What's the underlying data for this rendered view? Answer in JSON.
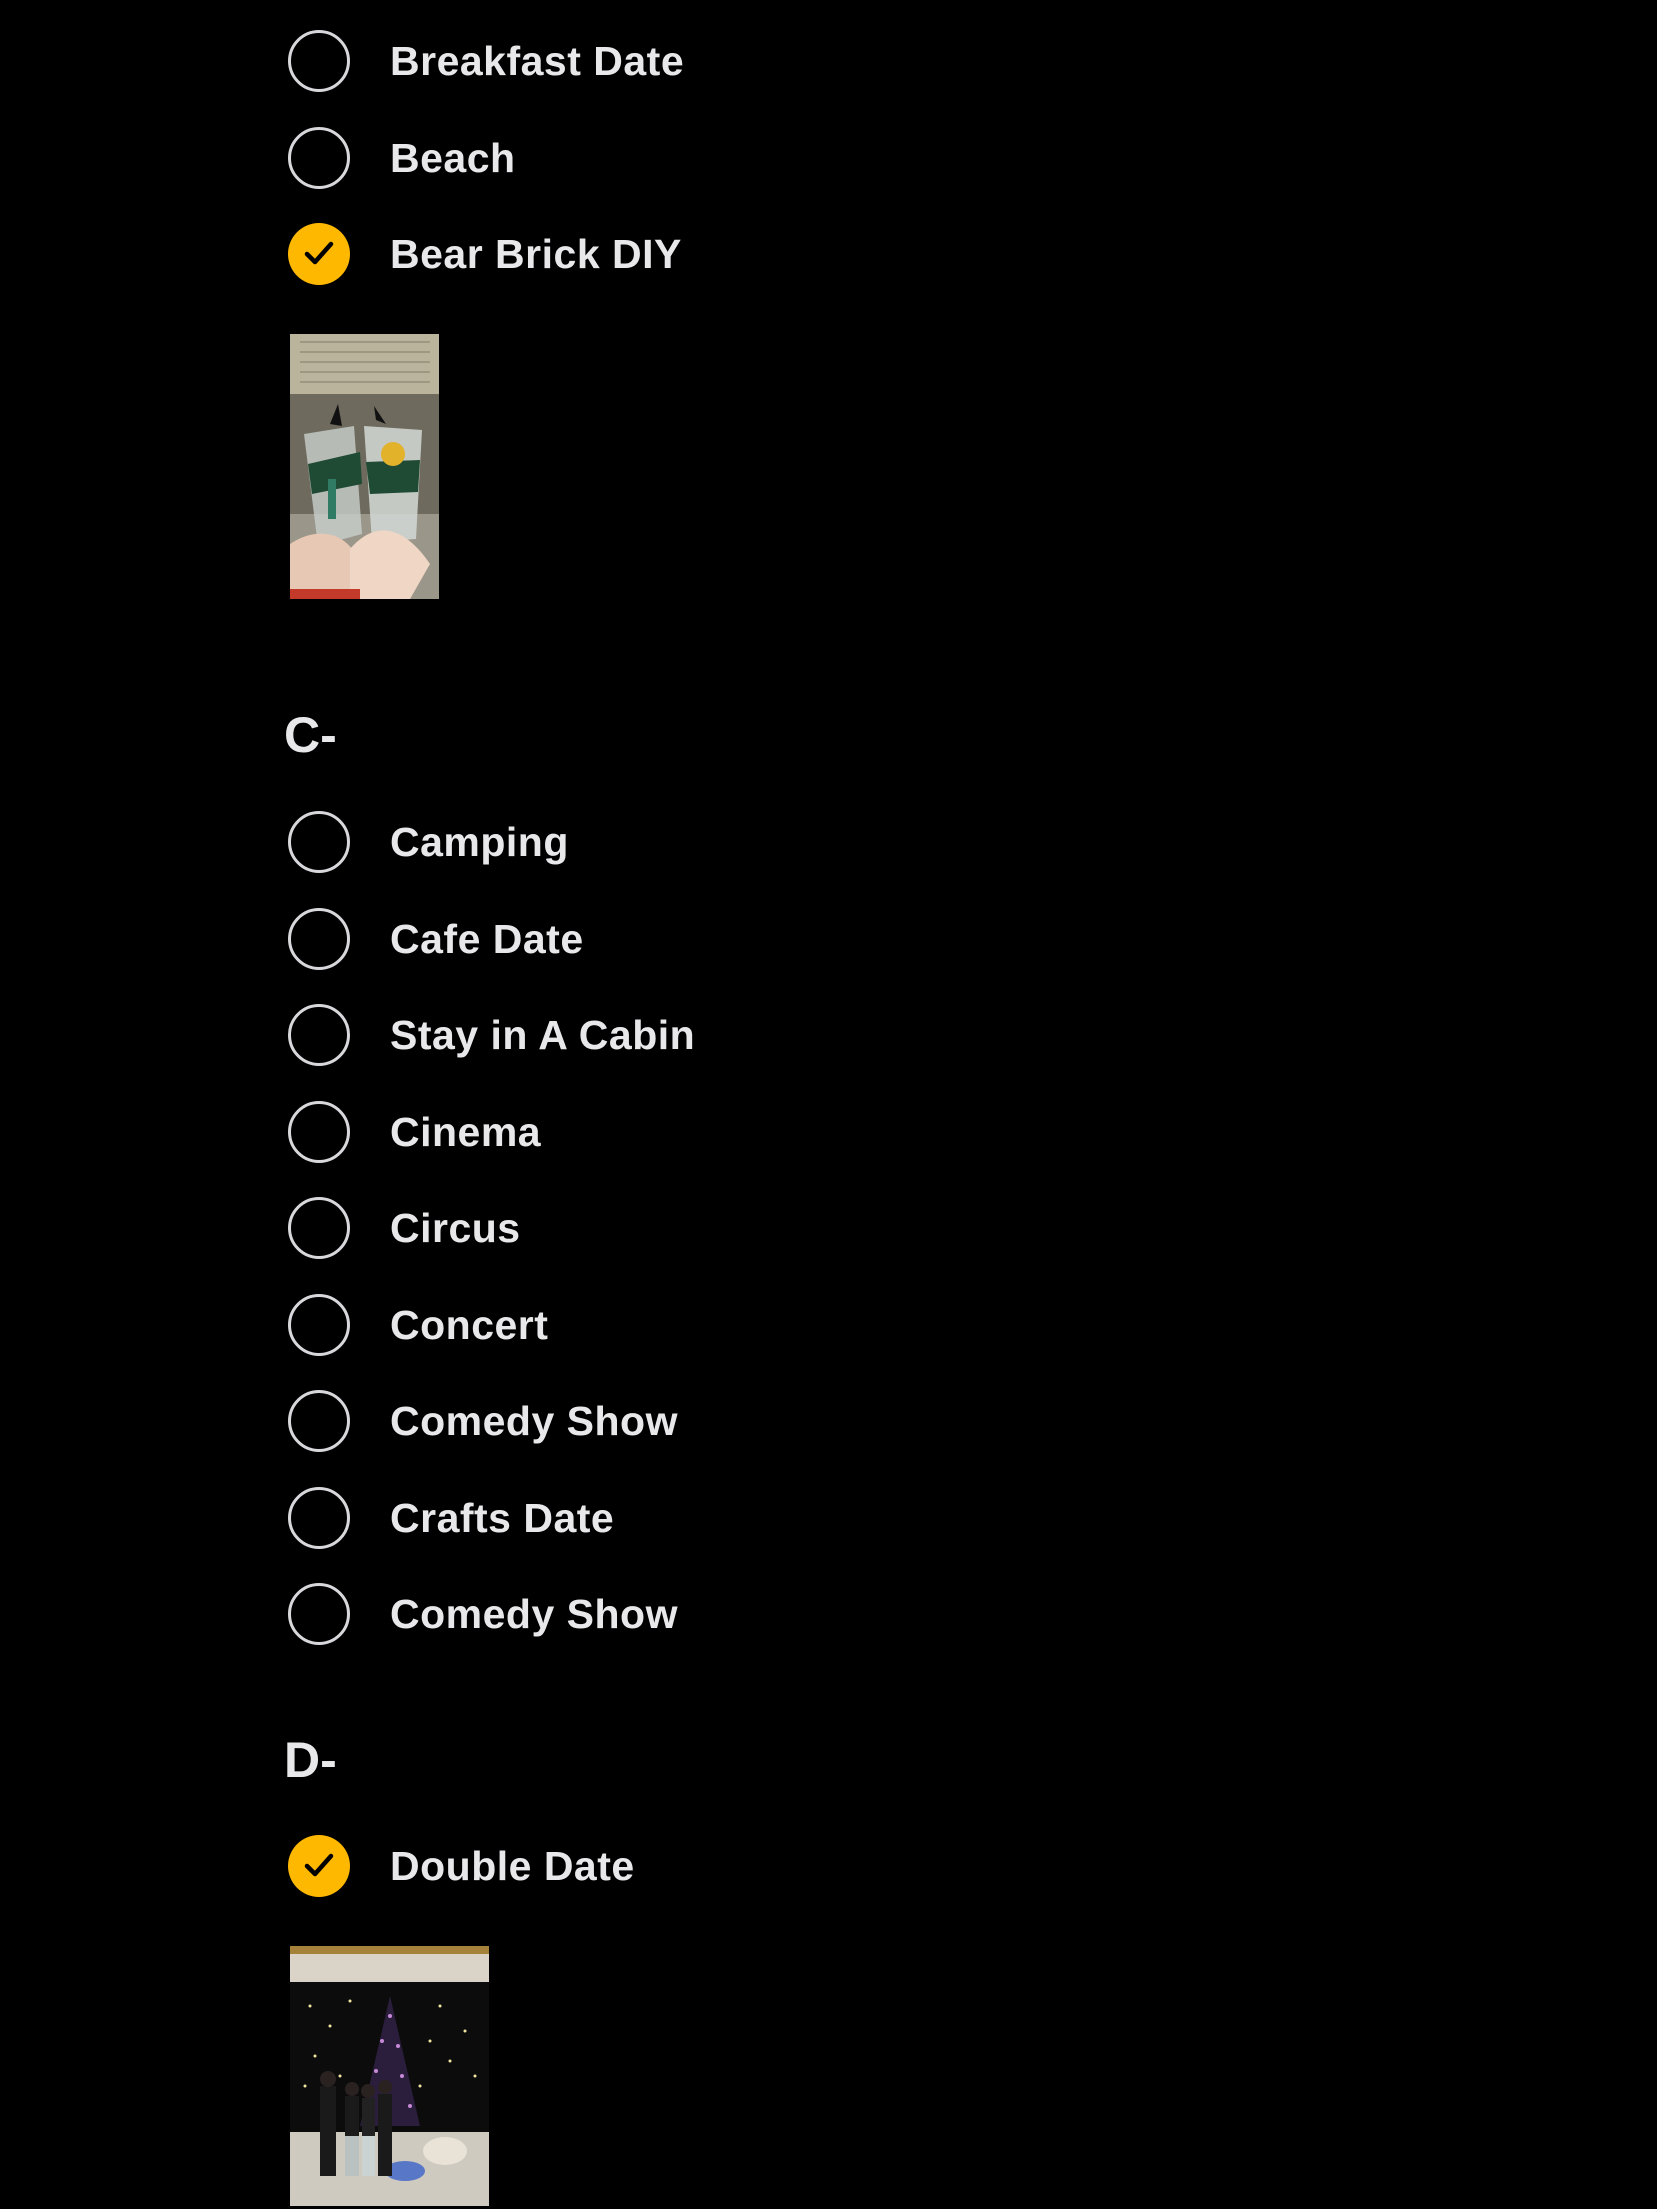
{
  "section_b": {
    "items": [
      {
        "label": "Breakfast Date",
        "checked": false
      },
      {
        "label": "Beach",
        "checked": false
      },
      {
        "label": "Bear Brick DIY",
        "checked": true
      }
    ]
  },
  "section_c": {
    "heading": "C-",
    "items": [
      {
        "label": "Camping",
        "checked": false
      },
      {
        "label": "Cafe Date",
        "checked": false
      },
      {
        "label": "Stay in A Cabin",
        "checked": false
      },
      {
        "label": "Cinema",
        "checked": false
      },
      {
        "label": "Circus",
        "checked": false
      },
      {
        "label": "Concert",
        "checked": false
      },
      {
        "label": "Comedy Show",
        "checked": false
      },
      {
        "label": "Crafts Date",
        "checked": false
      },
      {
        "label": "Comedy Show",
        "checked": false
      }
    ]
  },
  "section_d": {
    "heading": "D-",
    "items": [
      {
        "label": "Double Date",
        "checked": true
      }
    ]
  },
  "colors": {
    "background": "#000000",
    "checked_fill": "#ffb800",
    "text": "#e8e8ea",
    "circle_border": "#d8d8dc"
  },
  "icons": {
    "checked": "checkmark-icon"
  }
}
